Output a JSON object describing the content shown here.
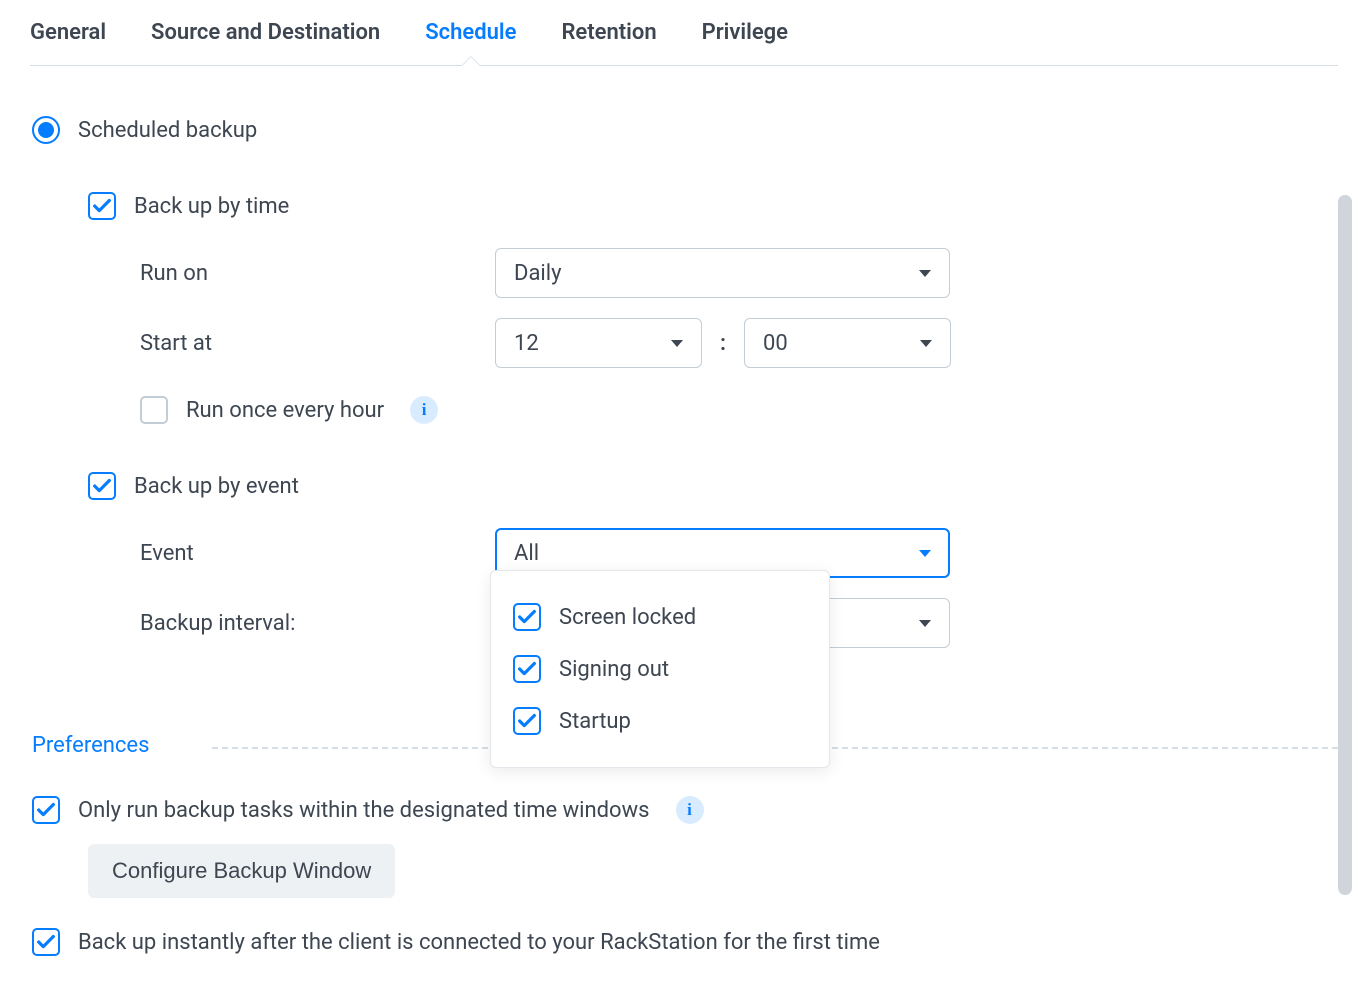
{
  "tabs": {
    "general": "General",
    "source": "Source and Destination",
    "schedule": "Schedule",
    "retention": "Retention",
    "privilege": "Privilege"
  },
  "schedule": {
    "scheduled_backup": "Scheduled backup",
    "backup_by_time": "Back up by time",
    "run_on_label": "Run on",
    "run_on_value": "Daily",
    "start_at_label": "Start at",
    "start_hour": "12",
    "start_minute": "00",
    "time_separator": ":",
    "run_hourly": "Run once every hour",
    "backup_by_event": "Back up by event",
    "event_label": "Event",
    "event_value": "All",
    "backup_interval_label": "Backup interval:",
    "event_options": {
      "screen_locked": "Screen locked",
      "signing_out": "Signing out",
      "startup": "Startup"
    }
  },
  "preferences": {
    "title": "Preferences",
    "time_windows": "Only run backup tasks within the designated time windows",
    "configure_btn": "Configure Backup Window",
    "instant_backup": "Back up instantly after the client is connected to your RackStation for the first time"
  },
  "info_glyph": "i"
}
